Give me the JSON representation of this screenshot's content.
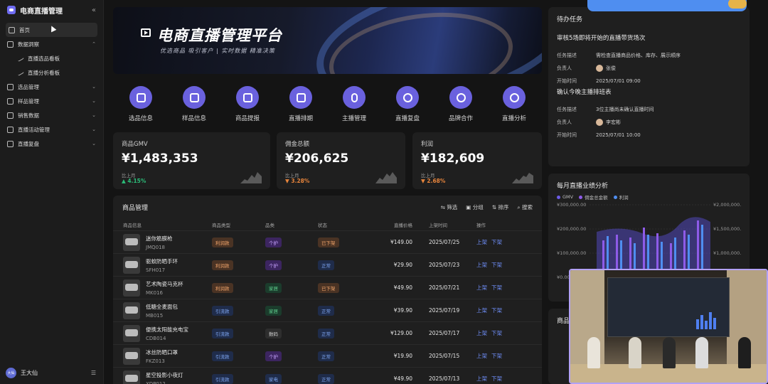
{
  "app": {
    "title": "电商直播管理"
  },
  "sidebar": {
    "items": [
      {
        "label": "首页",
        "active": true
      },
      {
        "label": "数据洞察",
        "expanded": true
      },
      {
        "label": "直播选品看板",
        "sub": true
      },
      {
        "label": "直播分析看板",
        "sub": true
      },
      {
        "label": "选品管理"
      },
      {
        "label": "样品管理"
      },
      {
        "label": "销售数据"
      },
      {
        "label": "直播活动管理"
      },
      {
        "label": "直播复盘"
      }
    ],
    "user": {
      "avatar": "大仙",
      "name": "王大仙"
    }
  },
  "banner": {
    "title": "电商直播管理平台",
    "subtitle": "优选商品 吸引客户 | 实时数据 精准决策"
  },
  "quick": [
    {
      "label": "选品信息",
      "icon": "grid-icon"
    },
    {
      "label": "样品信息",
      "icon": "layers-icon"
    },
    {
      "label": "商品提报",
      "icon": "box-icon"
    },
    {
      "label": "直播排期",
      "icon": "calendar-icon"
    },
    {
      "label": "主播管理",
      "icon": "mic-icon"
    },
    {
      "label": "直播复盘",
      "icon": "bulb-icon"
    },
    {
      "label": "品牌合作",
      "icon": "globe-icon"
    },
    {
      "label": "直播分析",
      "icon": "gauge-icon"
    }
  ],
  "stats": [
    {
      "label": "商品GMV",
      "value": "¥1,483,353",
      "compare": "比上月",
      "change": "4.15%",
      "dir": "up"
    },
    {
      "label": "佣金总额",
      "value": "¥206,625",
      "compare": "比上月",
      "change": "3.28%",
      "dir": "down"
    },
    {
      "label": "利润",
      "value": "¥182,609",
      "compare": "比上月",
      "change": "2.68%",
      "dir": "down"
    }
  ],
  "products": {
    "title": "商品管理",
    "tools": [
      "筛选",
      "分组",
      "排序",
      "搜索"
    ],
    "columns": [
      "商品信息",
      "商品类型",
      "品类",
      "状态",
      "直播价格",
      "上架时间",
      "操作"
    ],
    "actions": {
      "on": "上架",
      "off": "下架"
    },
    "rows": [
      {
        "name": "迷你筋膜枪",
        "code": "JMQ018",
        "type": "利润款",
        "cat": "个护",
        "status": "已下架",
        "price": "¥149.00",
        "date": "2025/07/25"
      },
      {
        "name": "驱蚊防晒手环",
        "code": "SFH017",
        "type": "利润款",
        "cat": "个护",
        "status": "正常",
        "price": "¥29.90",
        "date": "2025/07/23"
      },
      {
        "name": "艺术陶瓷马克杯",
        "code": "MK016",
        "type": "利润款",
        "cat": "家居",
        "status": "已下架",
        "price": "¥49.90",
        "date": "2025/07/21"
      },
      {
        "name": "低糖全麦面包",
        "code": "MB015",
        "type": "引流款",
        "cat": "家居",
        "status": "正常",
        "price": "¥39.90",
        "date": "2025/07/19"
      },
      {
        "name": "便携太阳能充电宝",
        "code": "CDB014",
        "type": "引流款",
        "cat": "数码",
        "status": "正常",
        "price": "¥129.00",
        "date": "2025/07/17"
      },
      {
        "name": "冰丝防晒口罩",
        "code": "FKZ013",
        "type": "引流款",
        "cat": "个护",
        "status": "正常",
        "price": "¥19.90",
        "date": "2025/07/15"
      },
      {
        "name": "星空投影小夜灯",
        "code": "XDP012",
        "type": "引流款",
        "cat": "家电",
        "status": "正常",
        "price": "¥49.90",
        "date": "2025/07/13"
      }
    ]
  },
  "tasks": {
    "title": "待办任务",
    "items": [
      {
        "title": "审核5场即将开始的直播带货场次",
        "desc_label": "任务描述",
        "desc": "需检查直播商品价格、库存、展示顺序",
        "owner_label": "负责人",
        "owner": "张俊",
        "time_label": "开始时间",
        "time": "2025/07/01   09:00"
      },
      {
        "title": "确认今晚主播排班表",
        "desc_label": "任务描述",
        "desc": "3位主播尚未确认直播时间",
        "owner_label": "负责人",
        "owner": "李宏彬",
        "time_label": "开始时间",
        "time": "2025/07/01   10:00"
      }
    ]
  },
  "chart_data": {
    "type": "bar",
    "title": "每月直播业绩分析",
    "legend": [
      "GMV",
      "佣金总金额",
      "利润"
    ],
    "colors": [
      "#6d5ce8",
      "#8e5be8",
      "#4f8ef0"
    ],
    "ylabels_left": [
      "¥300,000.00",
      "¥200,000.00",
      "¥100,000.00",
      "¥0.00"
    ],
    "ylabels_right": [
      "¥2,000,000.00",
      "¥1,500,000.00",
      "¥1,000,000.00"
    ]
  },
  "product_panel": {
    "title": "商品"
  }
}
